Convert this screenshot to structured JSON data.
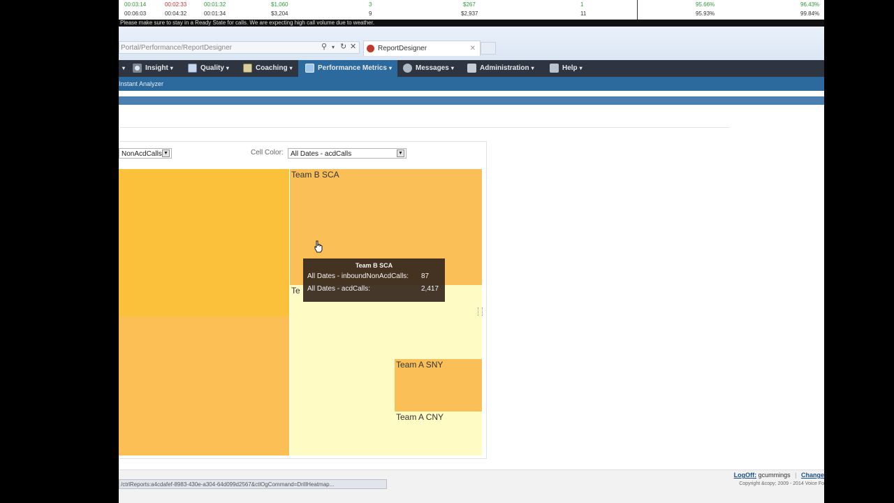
{
  "stats": {
    "row1": [
      "00:03:14",
      "00:02:33",
      "00:01:32",
      "$1,060",
      "3",
      "$267",
      "1",
      "95.66%",
      "96.43%"
    ],
    "row2": [
      "00:06:03",
      "00:04:32",
      "00:01:34",
      "$3,204",
      "9",
      "$2,937",
      "11",
      "95.93%",
      "99.84%"
    ]
  },
  "ticker": "Please make sure to stay in a Ready State for calls. We are expecting high call volume due to weather.",
  "browser": {
    "address": "Portal/Performance/ReportDesigner",
    "tab_title": "ReportDesigner",
    "tab_close": "✕"
  },
  "nav": {
    "items": [
      {
        "label": "Insight"
      },
      {
        "label": "Quality"
      },
      {
        "label": "Coaching"
      },
      {
        "label": "Performance Metrics"
      },
      {
        "label": "Messages"
      },
      {
        "label": "Administration"
      },
      {
        "label": "Help"
      }
    ],
    "subnav": "Instant Analyzer"
  },
  "report": {
    "size_select": "NonAcdCalls",
    "cell_color_label": "Cell Color:",
    "cell_color_select": "All Dates - acdCalls",
    "cells": [
      {
        "label": "Team B SCA"
      },
      {
        "label": "Team A SNY"
      },
      {
        "label": "Team A CNY"
      },
      {
        "label": "Te"
      }
    ],
    "tooltip": {
      "title": "Team B SCA",
      "line1_label": "All Dates - inboundNonAcdCalls:",
      "line1_value": "87",
      "line2_label": "All Dates - acdCalls:",
      "line2_value": "2,417"
    }
  },
  "footer": {
    "status_url": "/ctrlReports:a4cdafef-8983-430e-a304-64d099d2567&ctlOgCommand=DrillHeatmap...",
    "logoff": "LogOff:",
    "user": "gcummings",
    "change": "Change",
    "copyright": "Copyright &copy; 2009 - 2014 Voice Fo"
  },
  "colors": {
    "nav_bg": "#2e3540",
    "nav_active": "#2c6a9e",
    "cell_deep": "#fbc13a",
    "cell_mid": "#fbbf55",
    "cell_pale": "#fffbc5"
  }
}
